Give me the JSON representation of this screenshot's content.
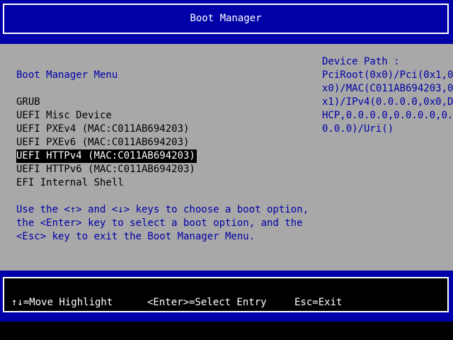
{
  "header": {
    "title": "Boot Manager"
  },
  "menu": {
    "heading": "Boot Manager Menu",
    "items": [
      {
        "label": "GRUB",
        "selected": false
      },
      {
        "label": "UEFI Misc Device",
        "selected": false
      },
      {
        "label": "UEFI PXEv4 (MAC:C011AB694203)",
        "selected": false
      },
      {
        "label": "UEFI PXEv6 (MAC:C011AB694203)",
        "selected": false
      },
      {
        "label": "UEFI HTTPv4 (MAC:C011AB694203)",
        "selected": true
      },
      {
        "label": "UEFI HTTPv6 (MAC:C011AB694203)",
        "selected": false
      },
      {
        "label": "EFI Internal Shell",
        "selected": false
      }
    ],
    "help_lines": [
      "Use the <↑> and <↓> keys to choose a boot option,",
      "the <Enter> key to select a boot option, and the",
      "<Esc> key to exit the Boot Manager Menu."
    ]
  },
  "device_path": {
    "label": "Device Path :",
    "lines": [
      "PciRoot(0x0)/Pci(0x1,0",
      "x0)/MAC(C011AB694203,0",
      "x1)/IPv4(0.0.0.0,0x0,D",
      "HCP,0.0.0.0,0.0.0.0,0.",
      "0.0.0)/Uri()"
    ]
  },
  "footer": {
    "move_highlight": "↑↓=Move Highlight",
    "select_entry": "<Enter>=Select Entry",
    "exit": "Esc=Exit"
  },
  "colors": {
    "background_gray": "#a8a8a8",
    "accent_blue": "#0000a8",
    "selection_bg": "#000000",
    "text_white": "#ffffff"
  }
}
